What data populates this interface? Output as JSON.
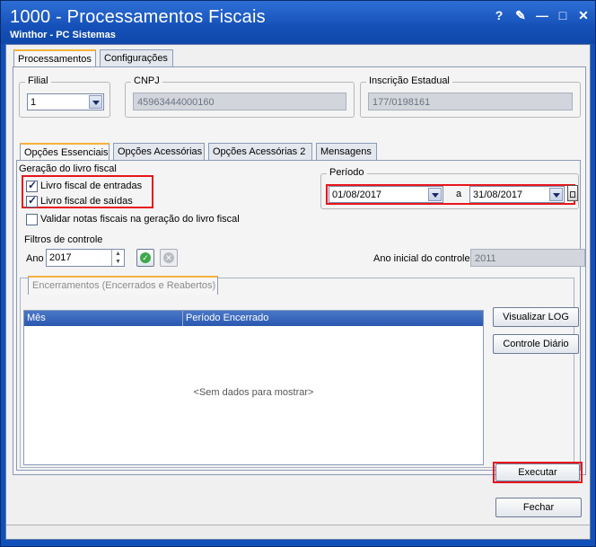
{
  "window": {
    "title": "1000 - Processamentos Fiscais",
    "subtitle": "Winthor - PC Sistemas",
    "buttons": [
      "?",
      "✎",
      "—",
      "□",
      "✕"
    ]
  },
  "main_tabs": [
    {
      "label": "Processamentos",
      "active": true
    },
    {
      "label": "Configurações",
      "active": false
    }
  ],
  "filial": {
    "label": "Filial",
    "value": "1"
  },
  "cnpj": {
    "label": "CNPJ",
    "value": "45963444000160"
  },
  "ie": {
    "label": "Inscrição Estadual",
    "value": "177/0198161"
  },
  "sub_tabs": [
    {
      "label": "Opções Essenciais",
      "active": true
    },
    {
      "label": "Opções Acessórias",
      "active": false
    },
    {
      "label": "Opções Acessórias 2",
      "active": false
    },
    {
      "label": "Mensagens",
      "active": false
    }
  ],
  "geracao": {
    "label": "Geração do livro fiscal",
    "entradas": {
      "label": "Livro fiscal de entradas",
      "checked": true
    },
    "saidas": {
      "label": "Livro fiscal de saídas",
      "checked": true
    },
    "validar": {
      "label": "Validar notas fiscais na geração do livro fiscal",
      "checked": false
    }
  },
  "periodo": {
    "label": "Período",
    "start": "01/08/2017",
    "sep": "a",
    "end": "31/08/2017"
  },
  "filtros": {
    "label": "Filtros de controle",
    "ano_label": "Ano",
    "ano_value": "2017",
    "ano_inicial_label": "Ano inicial do controle",
    "ano_inicial_value": "2011"
  },
  "encerramentos": {
    "tab_label": "Encerramentos (Encerrados e Reabertos)",
    "columns": [
      "Mês",
      "Período Encerrado"
    ],
    "empty": "<Sem dados para mostrar>"
  },
  "buttons": {
    "visualizar_log": "Visualizar LOG",
    "controle_diario": "Controle Diário",
    "executar": "Executar",
    "fechar": "Fechar"
  },
  "colors": {
    "highlight": "#e8161c",
    "titlebar": "#1550b8",
    "grid_header": "#2a58b0"
  }
}
